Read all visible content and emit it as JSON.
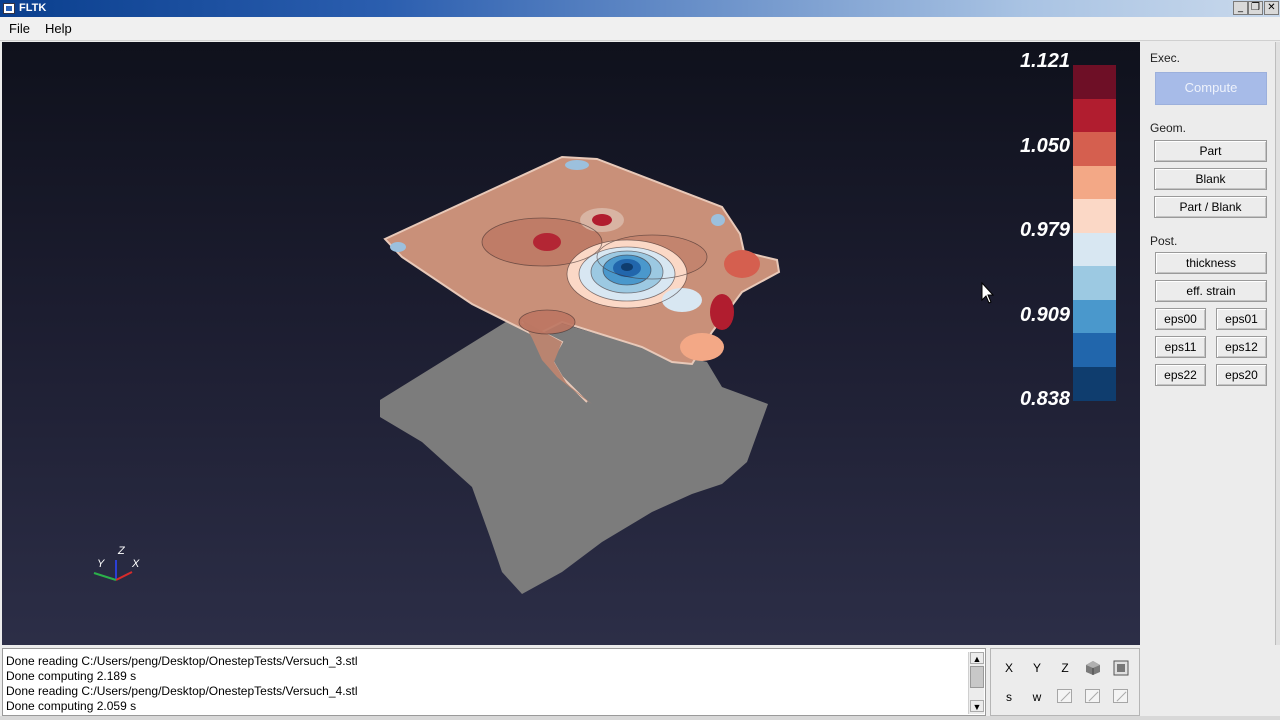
{
  "window": {
    "title": "FLTK",
    "controls": [
      "_",
      "❐",
      "✕"
    ]
  },
  "menu": {
    "items": [
      "File",
      "Help"
    ]
  },
  "legend": {
    "labels": [
      "1.121",
      "1.050",
      "0.979",
      "0.909",
      "0.838"
    ],
    "colors": [
      "#6e0f26",
      "#b11d2f",
      "#d55f4f",
      "#f3a886",
      "#fbd8c6",
      "#d8e7f2",
      "#9cc9e2",
      "#4a98cc",
      "#2166ac",
      "#0f3d6e"
    ]
  },
  "axes_triad": {
    "x": "X",
    "y": "Y",
    "z": "Z"
  },
  "panel": {
    "exec_label": "Exec.",
    "compute_label": "Compute",
    "geom_label": "Geom.",
    "part_label": "Part",
    "blank_label": "Blank",
    "part_blank_label": "Part / Blank",
    "post_label": "Post.",
    "thickness_label": "thickness",
    "eff_strain_label": "eff. strain",
    "eps": [
      "eps00",
      "eps01",
      "eps11",
      "eps12",
      "eps22",
      "eps20"
    ]
  },
  "console": {
    "lines": [
      "Done reading C:/Users/peng/Desktop/OnestepTests/Versuch_3.stl",
      "Done computing 2.189 s",
      "Done reading C:/Users/peng/Desktop/OnestepTests/Versuch_4.stl",
      "Done computing 2.059 s"
    ]
  },
  "view_tools": {
    "x": "X",
    "y": "Y",
    "z": "Z",
    "s": "s",
    "w": "w"
  },
  "colors": {
    "blank_gray": "#7c7c7c",
    "part_base": "#c99079",
    "accent_compute": "#a7bbe8"
  }
}
